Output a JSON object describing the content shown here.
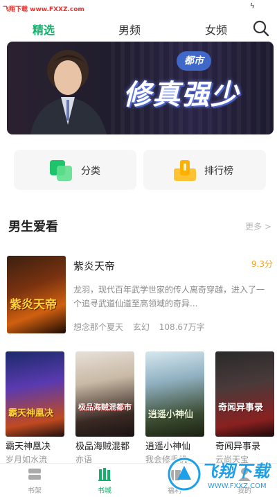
{
  "watermark_top": "飞翔下载 www.FXXZ.com",
  "tabs": [
    {
      "label": "精选",
      "active": true
    },
    {
      "label": "男频",
      "active": false
    },
    {
      "label": "女频",
      "active": false
    }
  ],
  "banner": {
    "tag": "都市",
    "title": "修真强少"
  },
  "quick_links": {
    "category": "分类",
    "ranking": "排行榜"
  },
  "section": {
    "title": "男生爱看",
    "more": "更多 >"
  },
  "featured_book": {
    "cover_text": "紫炎天帝",
    "title": "紫炎天帝",
    "score": "9.3分",
    "description": "龙羽，现代百年武学世家的传人离奇穿越，进入了一个追寻武道仙道至高领域的奇异...",
    "author": "想念那个夏天",
    "genre": "玄幻",
    "word_count": "108.67万字"
  },
  "books": [
    {
      "cover_text": "霸天神凰决",
      "name": "霸天神凰决",
      "author": "岁月如水流"
    },
    {
      "cover_text": "极品海贼混都市",
      "name": "极品海贼混都",
      "author": "亦语"
    },
    {
      "cover_text": "逍遥小神仙",
      "name": "逍遥小神仙",
      "author": "我会修手机"
    },
    {
      "cover_text": "奇闻异事录",
      "name": "奇闻异事录",
      "author": "云尚天宝"
    }
  ],
  "bottom_nav": [
    {
      "label": "书架",
      "icon": "bookshelf-icon",
      "active": false
    },
    {
      "label": "书城",
      "icon": "bookstore-icon",
      "active": true
    },
    {
      "label": "福利",
      "icon": "gift-icon",
      "active": false
    },
    {
      "label": "我的",
      "icon": "profile-icon",
      "active": false
    }
  ],
  "watermark_bottom": {
    "text": "飞翔下载",
    "url": "WWW.FXXZ.COM"
  },
  "colors": {
    "accent": "#16b06d",
    "score": "#f2a01e",
    "watermark": "#1ea0e8",
    "banner_tag": "#3f68c9"
  }
}
